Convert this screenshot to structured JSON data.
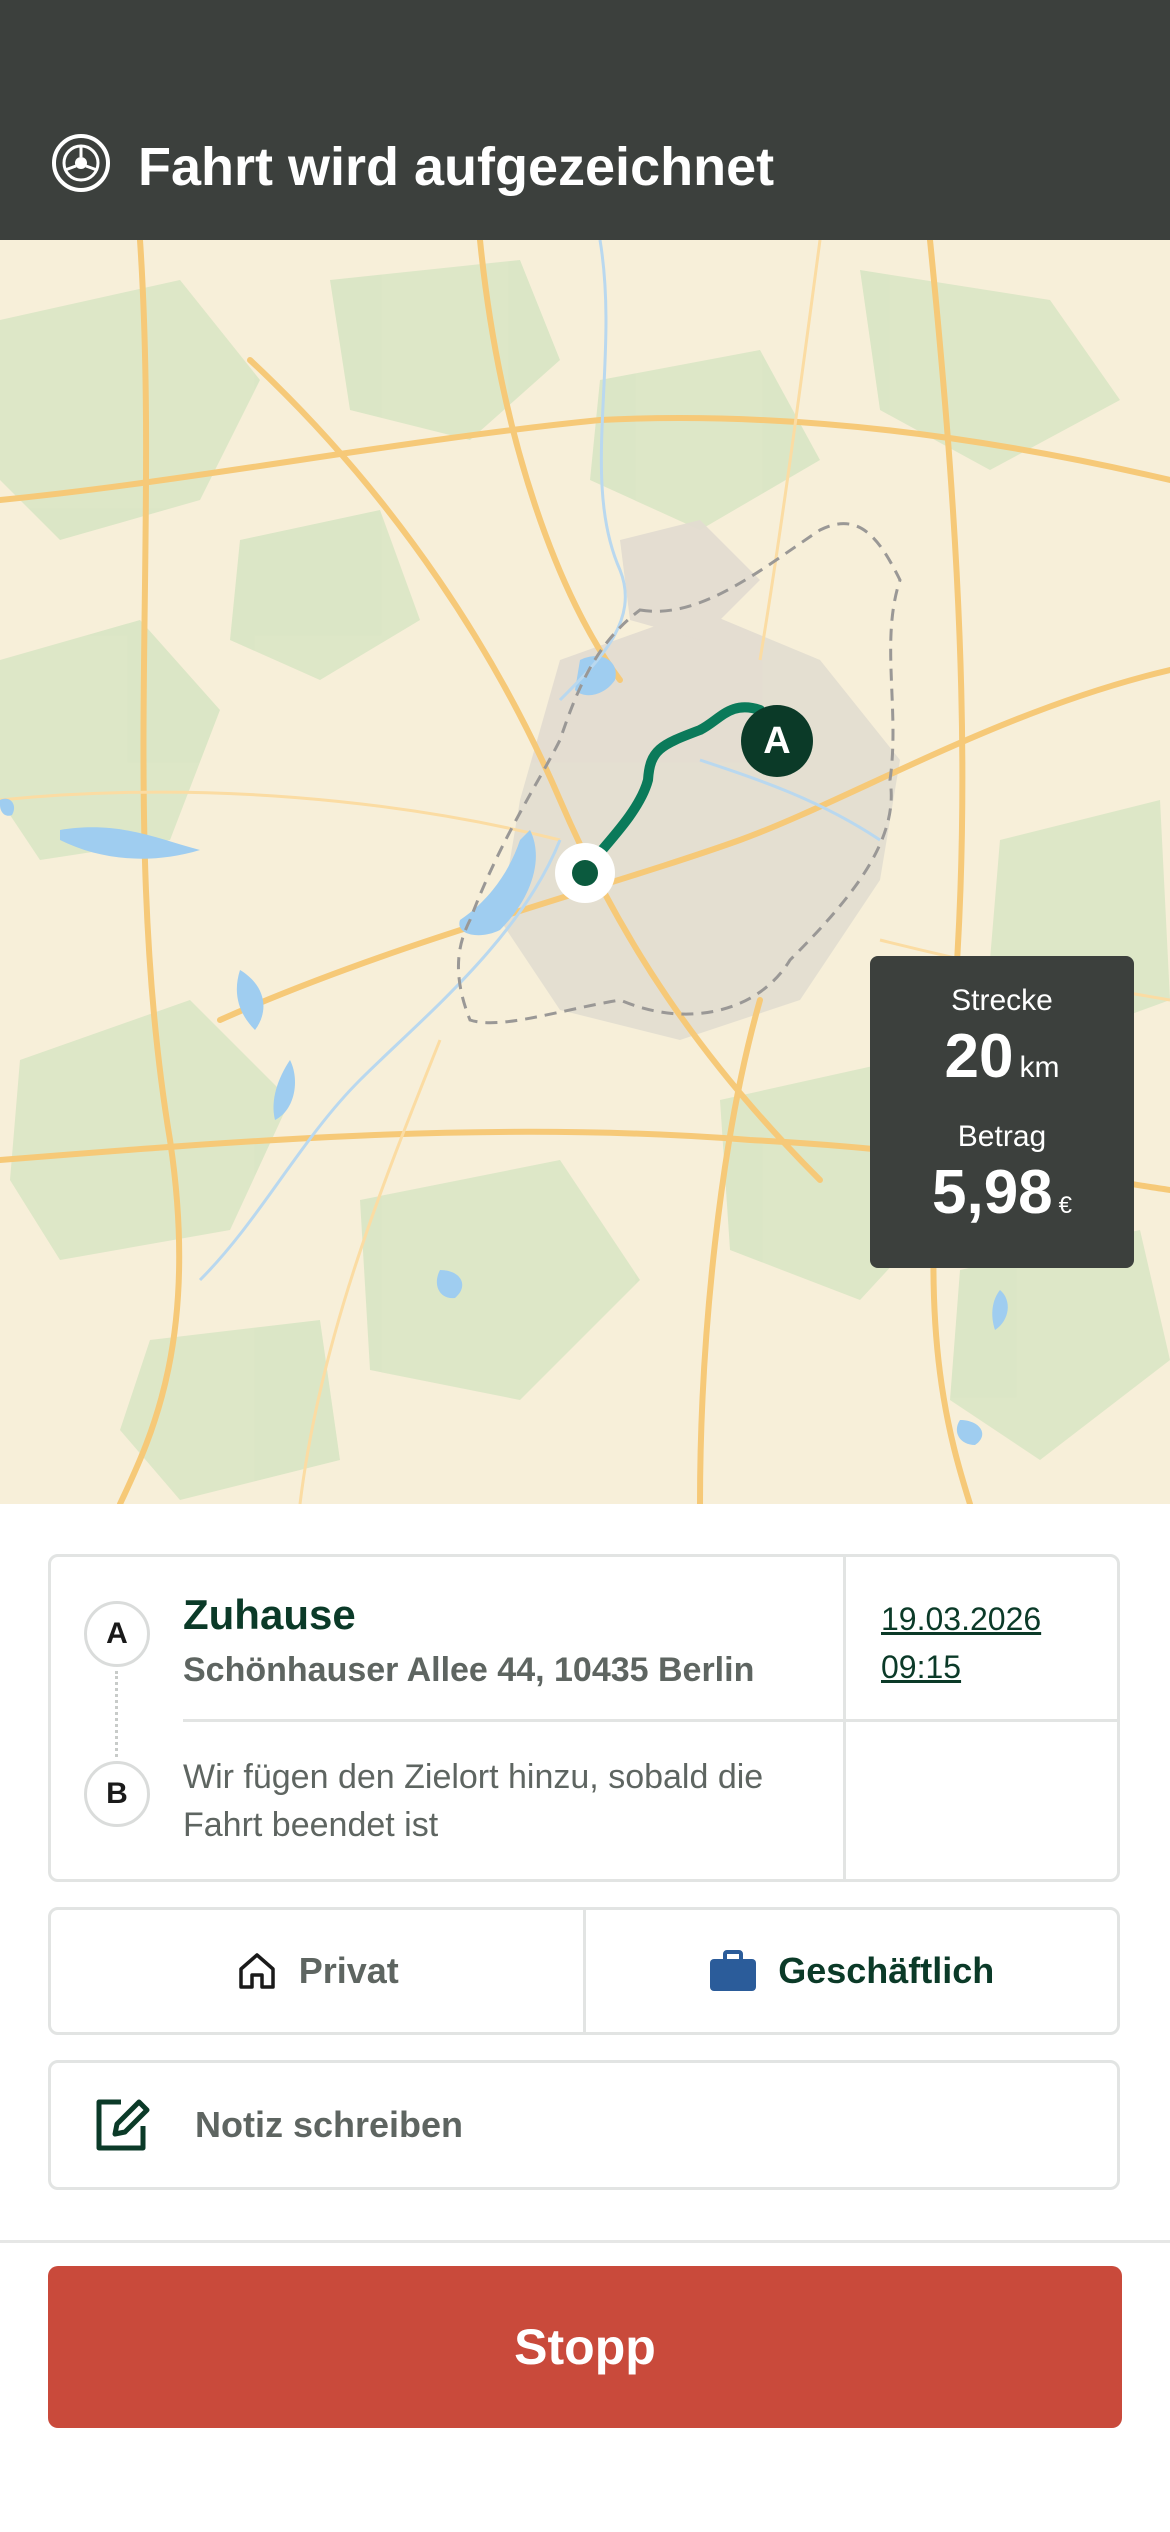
{
  "header": {
    "title": "Fahrt wird aufgezeichnet",
    "icon": "steering-wheel-icon"
  },
  "map": {
    "start_marker_label": "A",
    "route_color": "#0b7a5a",
    "stats": {
      "distance_label": "Strecke",
      "distance_value": "20",
      "distance_unit": "km",
      "amount_label": "Betrag",
      "amount_value": "5,98",
      "amount_unit": "€"
    }
  },
  "trip": {
    "start_label": "A",
    "start_name": "Zuhause",
    "start_address": "Schönhauser Allee 44, 10435 Berlin",
    "date": "19.03.2026",
    "time": "09:15",
    "end_label": "B",
    "end_info": "Wir fügen den Zielort hinzu, sobald die Fahrt beendet ist"
  },
  "category": {
    "private_label": "Privat",
    "private_icon": "house-icon",
    "business_label": "Geschäftlich",
    "business_icon": "briefcase-icon",
    "business_icon_color": "#2b5c9a"
  },
  "note": {
    "placeholder": "Notiz schreiben",
    "icon": "edit-note-icon"
  },
  "actions": {
    "stop_label": "Stopp",
    "stop_color": "#c94a3b"
  }
}
